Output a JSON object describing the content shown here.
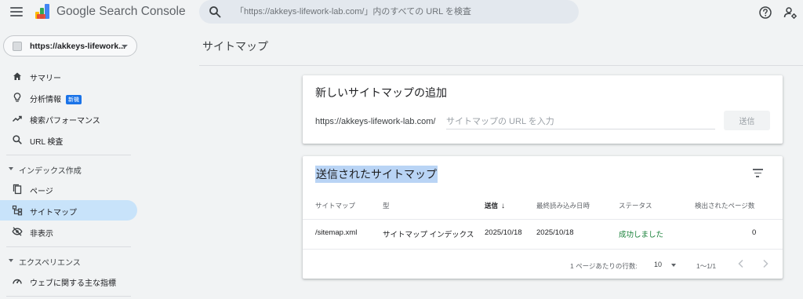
{
  "header": {
    "product_name": "Google Search Console",
    "search_placeholder": "「https://akkeys-lifework-lab.com/」内のすべての URL を検査",
    "icons": {
      "menu": "hamburger-icon",
      "search": "search-icon",
      "help": "help-icon",
      "account": "manage-accounts-icon"
    }
  },
  "sidebar": {
    "property_label": "https://akkeys-lifework...",
    "items_top": [
      {
        "label": "サマリー",
        "icon": "home-icon"
      },
      {
        "label": "分析情報",
        "icon": "lightbulb-icon",
        "badge": "新機"
      },
      {
        "label": "検索パフォーマンス",
        "icon": "trending-up-icon"
      },
      {
        "label": "URL 検査",
        "icon": "search-icon"
      }
    ],
    "section_index": "インデックス作成",
    "items_index": [
      {
        "label": "ページ",
        "icon": "pages-icon"
      },
      {
        "label": "サイトマップ",
        "icon": "sitemap-icon",
        "active": true
      },
      {
        "label": "非表示",
        "icon": "visibility-off-icon"
      }
    ],
    "section_experience": "エクスペリエンス",
    "items_experience": [
      {
        "label": "ウェブに関する主な指標",
        "icon": "speed-icon"
      }
    ]
  },
  "main": {
    "page_title": "サイトマップ",
    "add_card": {
      "title": "新しいサイトマップの追加",
      "url_prefix": "https://akkeys-lifework-lab.com/",
      "input_placeholder": "サイトマップの URL を入力",
      "input_value": "",
      "submit_label": "送信"
    },
    "submitted_card": {
      "title": "送信されたサイトマップ",
      "columns": [
        "サイトマップ",
        "型",
        "送信",
        "最終読み込み日時",
        "ステータス",
        "検出されたページ数"
      ],
      "sorted_column": "送信",
      "sort_arrow": "↓",
      "rows": [
        {
          "sitemap": "/sitemap.xml",
          "type": "サイトマップ インデックス",
          "submitted": "2025/10/18",
          "last_read": "2025/10/18",
          "status": "成功しました",
          "pages": "0"
        }
      ],
      "pagination": {
        "rows_per_page_label": "1 ページあたりの行数:",
        "rows_per_page": "10",
        "range": "1〜1/1"
      }
    }
  },
  "colors": {
    "active_nav": "#c8e3fa",
    "badge": "#1a73e8",
    "status_success": "#188038",
    "title_highlight": "#b9d4f5"
  }
}
